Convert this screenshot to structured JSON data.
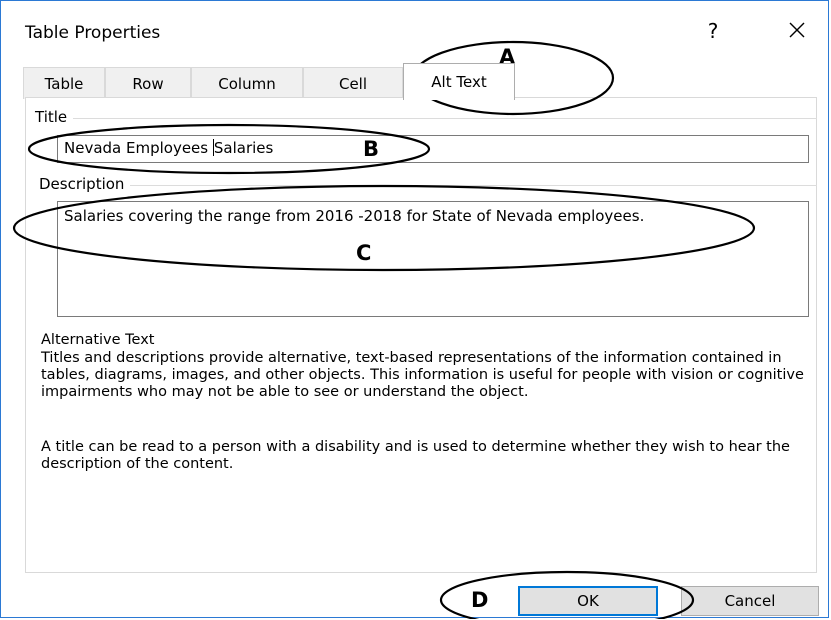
{
  "dialog": {
    "title": "Table Properties",
    "help_label": "?"
  },
  "tabs": [
    {
      "label": "Table"
    },
    {
      "label": "Row"
    },
    {
      "label": "Column"
    },
    {
      "label": "Cell"
    },
    {
      "label": "Alt Text",
      "active": true
    }
  ],
  "title_section": {
    "label": "Title",
    "value_before_caret": "Nevada Employees ",
    "value_after_caret": "Salaries"
  },
  "description_section": {
    "label": "Description",
    "value": "Salaries covering the range from 2016 -2018 for State of Nevada employees."
  },
  "info": {
    "heading": "Alternative Text",
    "paragraph1": "Titles and descriptions provide alternative, text-based representations of the information contained in tables, diagrams, images, and other objects. This information is useful for people with vision or cognitive impairments who may not be able to see or understand the object.",
    "paragraph2": "A title can be read to a person with a disability and is used to determine whether they wish to hear the description of the content."
  },
  "buttons": {
    "ok": "OK",
    "cancel": "Cancel"
  },
  "annotations": {
    "a": "A",
    "b": "B",
    "c": "C",
    "d": "D"
  },
  "colors": {
    "focus_border": "#0078d7",
    "window_border": "#2b79d4",
    "button_face": "#e1e1e1"
  }
}
